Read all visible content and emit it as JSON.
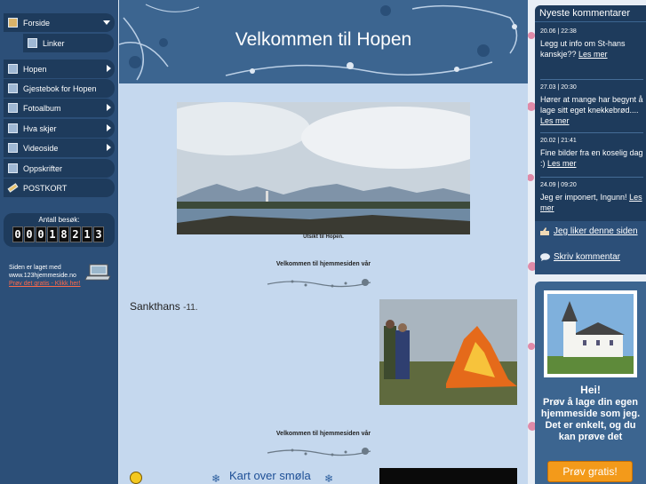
{
  "sidebar": {
    "items": [
      {
        "label": "Forside",
        "icon": "home-icon"
      },
      {
        "label": "Linker",
        "icon": "page-icon"
      },
      {
        "label": "Hopen",
        "icon": "page-icon"
      },
      {
        "label": "Gjestebok for Hopen",
        "icon": "book-icon"
      },
      {
        "label": "Fotoalbum",
        "icon": "photo-icon"
      },
      {
        "label": "Hva skjer",
        "icon": "page-icon"
      },
      {
        "label": "Videoside",
        "icon": "video-icon"
      },
      {
        "label": "Oppskrifter",
        "icon": "page-icon"
      },
      {
        "label": "POSTKORT",
        "icon": "pencil-icon"
      }
    ],
    "counter": {
      "label": "Antall besøk:",
      "digits": [
        "0",
        "0",
        "0",
        "1",
        "8",
        "2",
        "1",
        "3"
      ]
    },
    "madewith": {
      "line1": "Siden er laget med",
      "line2": "www.123hjemmeside.no",
      "try": "Prøv det gratis - Klikk her!"
    }
  },
  "header": {
    "title": "Velkommen til Hopen"
  },
  "main": {
    "photo_caption": "Utsikt til Hopen.",
    "welcome1": "Velkommen til hjemmesiden vår",
    "sankthans": "Sankthans",
    "sankthans_year": "-11.",
    "welcome2": "Velkommen til hjemmesiden vår",
    "kart": "Kart over smøla"
  },
  "comments": {
    "title": "Nyeste kommentarer",
    "items": [
      {
        "date": "20.06 | 22:38",
        "text": "Legg ut info om St-hans kanskje?? ",
        "more": "Les mer"
      },
      {
        "date": "27.03 | 20:30",
        "text": "Hører at mange har begynt å lage sitt eget knekkebrød.... ",
        "more": "Les mer"
      },
      {
        "date": "20.02 | 21:41",
        "text": "Fine bilder fra en koselig dag :) ",
        "more": "Les mer"
      },
      {
        "date": "24.09 | 09:20",
        "text": "Jeg er imponert, Ingunn! ",
        "more": "Les mer"
      }
    ],
    "like": "Jeg liker denne siden",
    "write": "Skriv kommentar"
  },
  "promo": {
    "hei": "Hei!",
    "text": "Prøv å lage din egen hjemmeside som jeg. Det er enkelt, og du kan prøve det",
    "button": "Prøv gratis!"
  },
  "colors": {
    "sidebar": "#2c4f78",
    "nav": "#1e3b5c",
    "content": "#c5d8ee",
    "accent": "#f39a1a"
  }
}
